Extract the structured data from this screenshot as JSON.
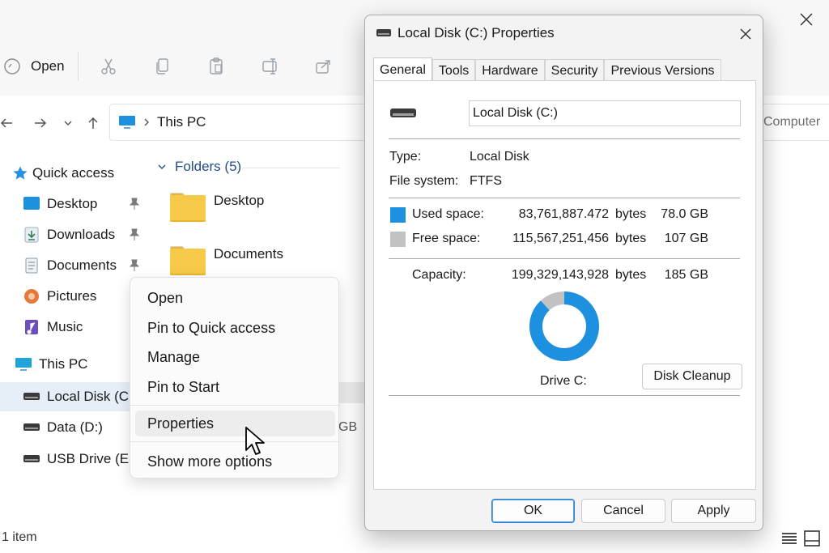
{
  "explorer": {
    "toolbar": {
      "open_label": "Open"
    },
    "address": {
      "location": "This PC"
    },
    "search_fragment": "Computer",
    "sidebar": {
      "quick_access": "Quick access",
      "items": [
        {
          "label": "Desktop",
          "icon": "desktop-icon",
          "pinned": true
        },
        {
          "label": "Downloads",
          "icon": "downloads-icon",
          "pinned": true
        },
        {
          "label": "Documents",
          "icon": "documents-icon",
          "pinned": true
        },
        {
          "label": "Pictures",
          "icon": "pictures-icon",
          "pinned": false
        },
        {
          "label": "Music",
          "icon": "music-icon",
          "pinned": false
        }
      ],
      "this_pc": "This PC",
      "drives": [
        {
          "label": "Local Disk (C:)",
          "selected": true
        },
        {
          "label": "Data (D:)",
          "selected": false
        },
        {
          "label": "USB Drive (E:)",
          "selected": false
        }
      ]
    },
    "folders_header": "Folders (5)",
    "folders": [
      "Desktop",
      "Documents"
    ],
    "fragment_gb": "GB",
    "status": "1 item",
    "colors": {
      "accent": "#0067c0",
      "selection": "#e6eef8",
      "folder": "#f7c948"
    }
  },
  "context_menu": {
    "items": [
      {
        "label": "Open"
      },
      {
        "label": "Pin to Quick access"
      },
      {
        "label": "Manage"
      },
      {
        "label": "Pin to Start"
      },
      {
        "label": "Properties",
        "highlighted": true
      },
      {
        "label": "Show more options"
      }
    ]
  },
  "dialog": {
    "title": "Local Disk (C:) Properties",
    "tabs": [
      "General",
      "Tools",
      "Hardware",
      "Security",
      "Previous Versions"
    ],
    "active_tab": "General",
    "name_value": "Local Disk (C:)",
    "type_label": "Type:",
    "type_value": "Local Disk",
    "fs_label": "File system:",
    "fs_value": "FTFS",
    "used": {
      "label": "Used space:",
      "bytes": "83,761,887.472",
      "unit": "bytes",
      "size": "78.0 GB",
      "color": "#1e90e0"
    },
    "free": {
      "label": "Free space:",
      "bytes": "115,567,251,456",
      "unit": "bytes",
      "size": "107 GB",
      "color": "#c2c2c2"
    },
    "capacity": {
      "label": "Capacity:",
      "bytes": "199,329,143,928",
      "unit": "bytes",
      "size": "185 GB"
    },
    "used_fraction": 0.88,
    "drive_label": "Drive C:",
    "disk_cleanup": "Disk Cleanup",
    "buttons": {
      "ok": "OK",
      "cancel": "Cancel",
      "apply": "Apply"
    }
  }
}
